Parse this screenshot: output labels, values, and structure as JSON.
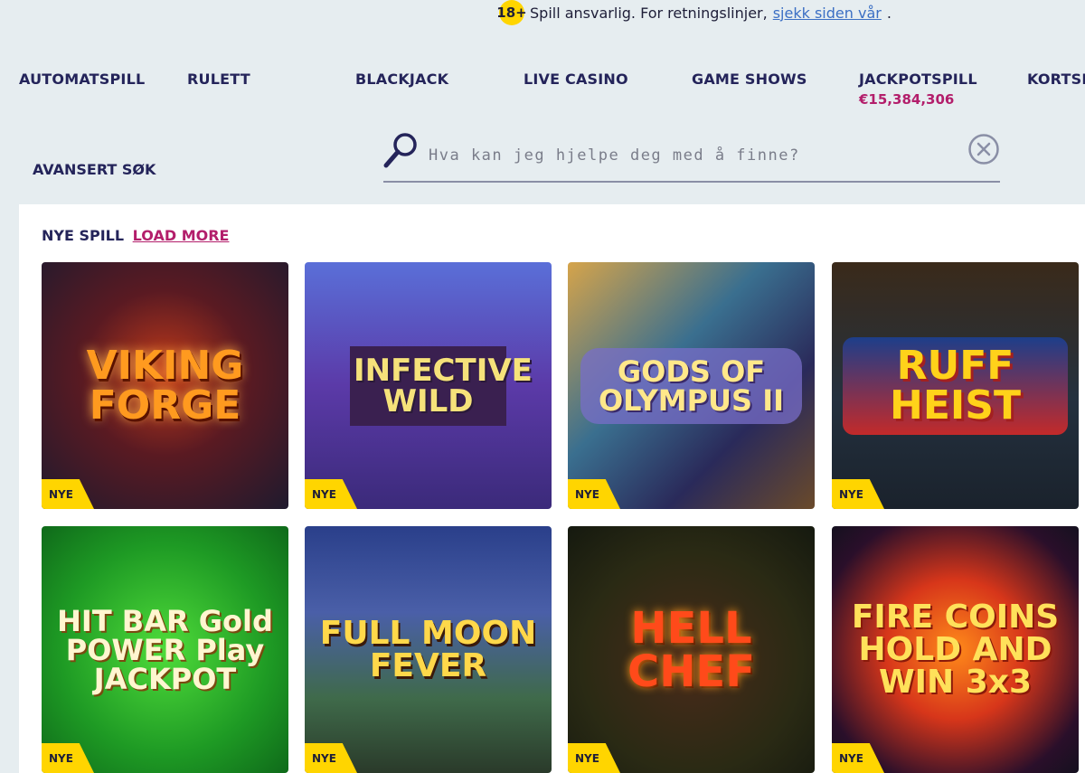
{
  "notice": {
    "age_badge": "18+",
    "text": "Spill ansvarlig. For retningslinjer,",
    "link": "sjekk siden vår",
    "after_link": "."
  },
  "nav": {
    "items": [
      {
        "label": "AUTOMATSPILL"
      },
      {
        "label": "RULETT"
      },
      {
        "label": "BLACKJACK"
      },
      {
        "label": "LIVE CASINO"
      },
      {
        "label": "GAME SHOWS"
      },
      {
        "label": "JACKPOTSPILL"
      },
      {
        "label": "KORTSP"
      }
    ],
    "jackpot_amount": "€15,384,306",
    "advanced_search": "AVANSERT SØK"
  },
  "search": {
    "placeholder": "Hva kan jeg hjelpe deg med å finne?",
    "value": ""
  },
  "section": {
    "title": "NYE SPILL",
    "load_more": "LOAD MORE"
  },
  "games": [
    {
      "title": "VIKING FORGE",
      "badge": "NYE"
    },
    {
      "title": "INFECTIVE WILD",
      "badge": "NYE"
    },
    {
      "title": "GODS OF OLYMPUS II",
      "badge": "NYE"
    },
    {
      "title": "RUFF HEIST",
      "badge": "NYE"
    },
    {
      "title": "HIT BAR Gold POWER Play JACKPOT",
      "badge": "NYE"
    },
    {
      "title": "FULL MOON FEVER",
      "badge": "NYE"
    },
    {
      "title": "HELL CHEF",
      "badge": "NYE"
    },
    {
      "title": "FIRE COINS HOLD AND WIN 3x3",
      "badge": "NYE"
    }
  ],
  "colors": {
    "page_bg": "#e6edf0",
    "nav_text": "#24245a",
    "accent": "#b31e6b",
    "badge_yellow": "#ffd500",
    "link_blue": "#3b6fc4"
  }
}
